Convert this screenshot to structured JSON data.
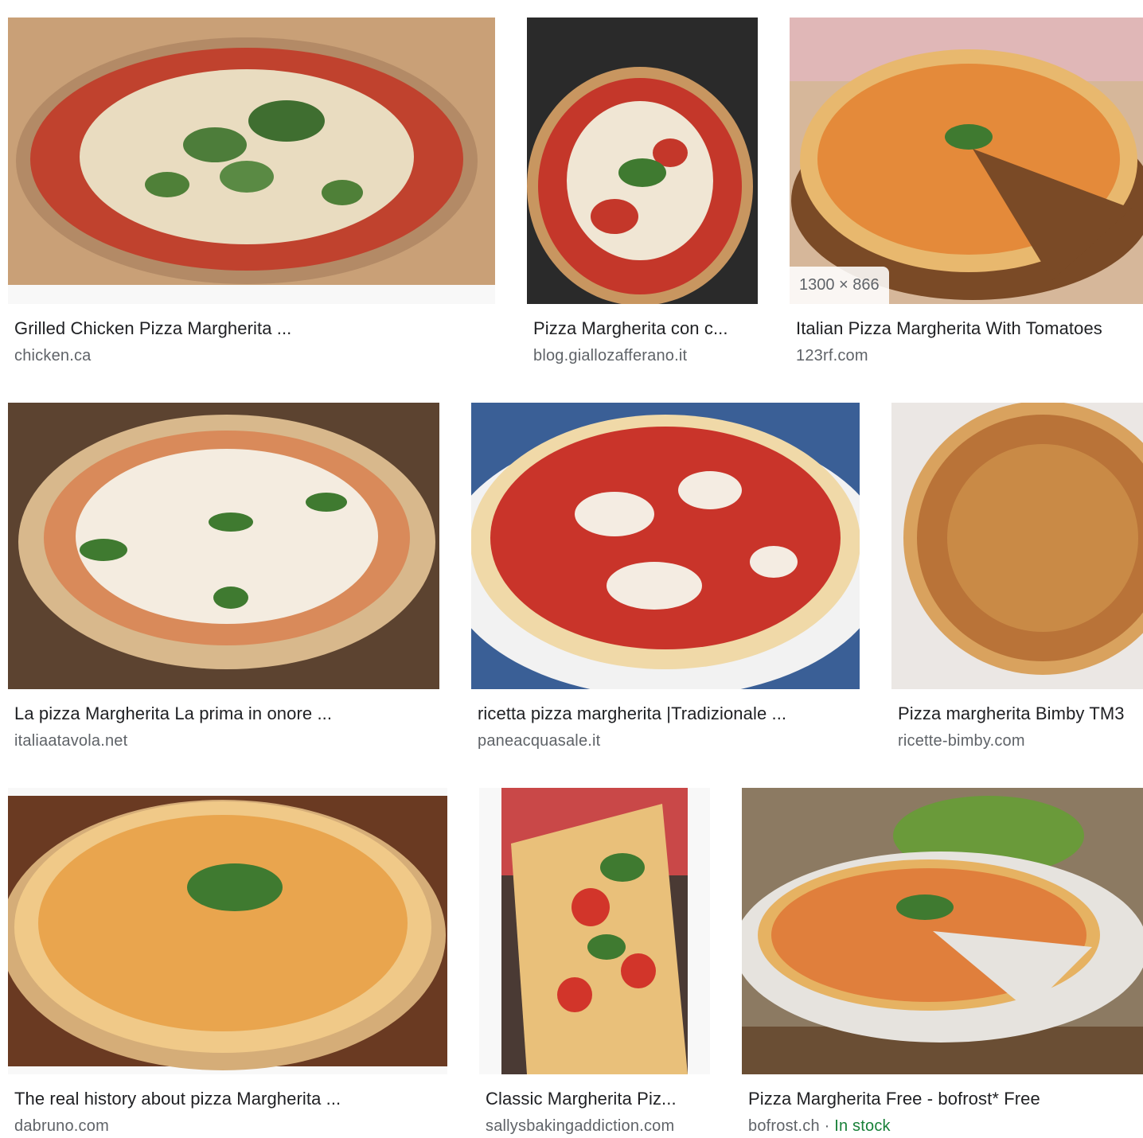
{
  "results": [
    {
      "title": "Grilled Chicken Pizza Margherita ...",
      "source": "chicken.ca",
      "image": "pizza-chicken-margherita-image"
    },
    {
      "title": "Pizza Margherita con c...",
      "source": "blog.giallozafferano.it",
      "image": "pizza-margherita-dark-background-image"
    },
    {
      "title": "Italian Pizza Margherita With Tomatoes",
      "source": "123rf.com",
      "dimensions": "1300 × 866",
      "image": "pizza-sliced-on-wooden-board-image"
    },
    {
      "title": "La pizza Margherita La prima in onore ...",
      "source": "italiaatavola.net",
      "image": "pizza-margherita-basil-wood-table-image"
    },
    {
      "title": "ricetta pizza margherita |Tradizionale ...",
      "source": "paneacquasale.it",
      "image": "pizza-margherita-blue-plate-image"
    },
    {
      "title": "Pizza margherita Bimby TM3",
      "source": "ricette-bimby.com",
      "image": "pizza-golden-crust-image"
    },
    {
      "title": "The real history about pizza Margherita ...",
      "source": "dabruno.com",
      "image": "pizza-cheese-basil-closeup-image"
    },
    {
      "title": "Classic Margherita Piz...",
      "source": "sallysbakingaddiction.com",
      "image": "pizza-slices-tomato-basil-image"
    },
    {
      "title": "Pizza Margherita Free - bofrost* Free",
      "source": "bofrost.ch",
      "separator": " · ",
      "stock": "In stock",
      "image": "frozen-pizza-plate-image"
    }
  ],
  "colors": {
    "title": "#202124",
    "source": "#5f6368",
    "stock": "#188038"
  }
}
